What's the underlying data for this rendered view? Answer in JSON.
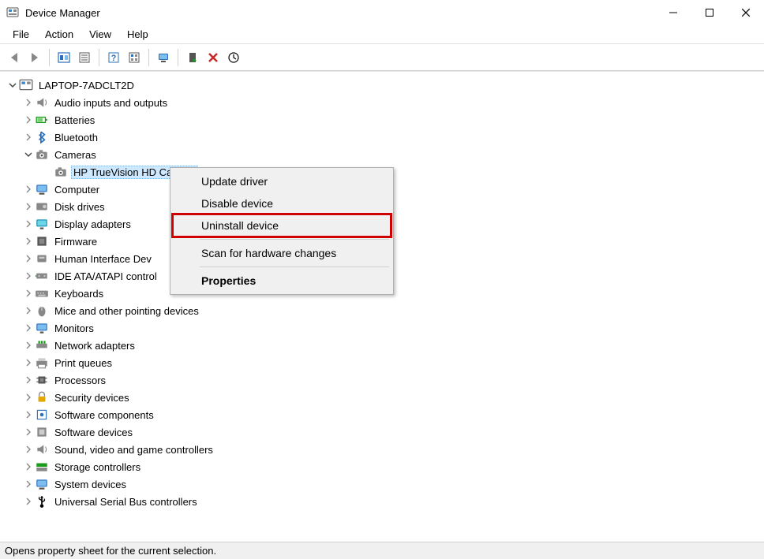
{
  "window": {
    "title": "Device Manager"
  },
  "menus": {
    "file": "File",
    "action": "Action",
    "view": "View",
    "help": "Help"
  },
  "tree": {
    "root": "LAPTOP-7ADCLT2D",
    "categories": [
      {
        "label": "Audio inputs and outputs",
        "icon": "speaker"
      },
      {
        "label": "Batteries",
        "icon": "battery"
      },
      {
        "label": "Bluetooth",
        "icon": "bluetooth"
      },
      {
        "label": "Cameras",
        "icon": "camera",
        "expanded": true,
        "children": [
          {
            "label": "HP TrueVision HD Camera",
            "icon": "camera",
            "selected": true
          }
        ]
      },
      {
        "label": "Computer",
        "icon": "computer"
      },
      {
        "label": "Disk drives",
        "icon": "disk"
      },
      {
        "label": "Display adapters",
        "icon": "display"
      },
      {
        "label": "Firmware",
        "icon": "firmware"
      },
      {
        "label": "Human Interface Devices",
        "icon": "hid"
      },
      {
        "label": "IDE ATA/ATAPI controllers",
        "icon": "ide"
      },
      {
        "label": "Keyboards",
        "icon": "keyboard"
      },
      {
        "label": "Mice and other pointing devices",
        "icon": "mouse"
      },
      {
        "label": "Monitors",
        "icon": "monitor"
      },
      {
        "label": "Network adapters",
        "icon": "network"
      },
      {
        "label": "Print queues",
        "icon": "printer"
      },
      {
        "label": "Processors",
        "icon": "cpu"
      },
      {
        "label": "Security devices",
        "icon": "security"
      },
      {
        "label": "Software components",
        "icon": "swcomp"
      },
      {
        "label": "Software devices",
        "icon": "swdev"
      },
      {
        "label": "Sound, video and game controllers",
        "icon": "sound"
      },
      {
        "label": "Storage controllers",
        "icon": "storage"
      },
      {
        "label": "System devices",
        "icon": "system"
      },
      {
        "label": "Universal Serial Bus controllers",
        "icon": "usb"
      }
    ],
    "truncated": {
      "hid": "Human Interface Dev",
      "ide": "IDE ATA/ATAPI control"
    }
  },
  "context_menu": {
    "update_driver": "Update driver",
    "disable_device": "Disable device",
    "uninstall_device": "Uninstall device",
    "scan_changes": "Scan for hardware changes",
    "properties": "Properties"
  },
  "status": "Opens property sheet for the current selection."
}
